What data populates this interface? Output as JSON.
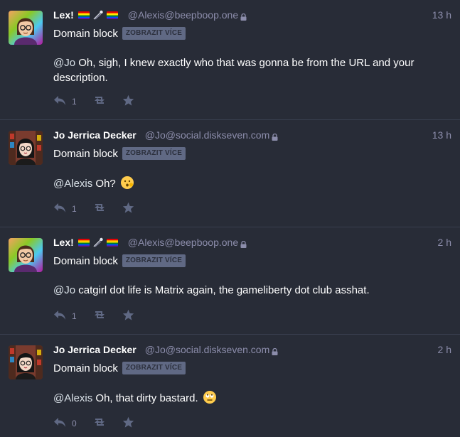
{
  "colors": {
    "background": "#282c37",
    "divider": "#393f4f",
    "secondary_text": "#8c8dab",
    "cw_button_bg": "#606984",
    "action_icon": "#606984"
  },
  "posts": [
    {
      "display_name": "Lex!",
      "emojis": [
        "rainbow-flag",
        "comet",
        "rainbow-flag"
      ],
      "handle": "@Alexis@beepboop.one",
      "locked": true,
      "time": "13 h",
      "spoiler": "Domain block",
      "cw_button": "ZOBRAZIT VÍCE",
      "mention": "@Jo",
      "text": " Oh, sigh, I knew exactly who that was gonna be from the URL and your description.",
      "reply_count": "1",
      "avatar": "avatar-lex"
    },
    {
      "display_name": "Jo Jerrica Decker",
      "emojis": [],
      "handle": "@Jo@social.diskseven.com",
      "locked": true,
      "time": "13 h",
      "spoiler": "Domain block",
      "cw_button": "ZOBRAZIT VÍCE",
      "mention": "@Alexis",
      "text": " Oh?",
      "trailing_emoji": "hushed-face-emoji",
      "reply_count": "1",
      "avatar": "avatar-jo"
    },
    {
      "display_name": "Lex!",
      "emojis": [
        "rainbow-flag",
        "comet",
        "rainbow-flag"
      ],
      "handle": "@Alexis@beepboop.one",
      "locked": true,
      "time": "2 h",
      "spoiler": "Domain block",
      "cw_button": "ZOBRAZIT VÍCE",
      "mention": "@Jo",
      "text": " catgirl dot life is Matrix again, the gameliberty dot club asshat.",
      "reply_count": "1",
      "avatar": "avatar-lex"
    },
    {
      "display_name": "Jo Jerrica Decker",
      "emojis": [],
      "handle": "@Jo@social.diskseven.com",
      "locked": true,
      "time": "2 h",
      "spoiler": "Domain block",
      "cw_button": "ZOBRAZIT VÍCE",
      "mention": "@Alexis",
      "text": " Oh, that dirty bastard.",
      "trailing_emoji": "rolling-eyes-emoji",
      "reply_count": "0",
      "avatar": "avatar-jo"
    }
  ]
}
